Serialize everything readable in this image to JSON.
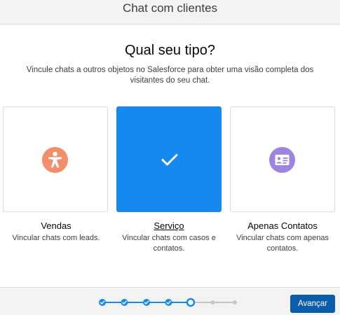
{
  "header": {
    "title": "Chat com clientes"
  },
  "main": {
    "question": "Qual seu tipo?",
    "description": "Vincule chats a outros objetos no Salesforce para obter uma visão completa dos visitantes do seu chat."
  },
  "cards": [
    {
      "title": "Vendas",
      "subtitle": "Vincular chats com leads.",
      "icon": "person-icon",
      "icon_color": "#f38d6a",
      "selected": false
    },
    {
      "title": "Serviço",
      "subtitle": "Vincular chats com casos e contatos.",
      "icon": "checkmark-icon",
      "icon_color": "#ffffff",
      "selected": true
    },
    {
      "title": "Apenas Contatos",
      "subtitle": "Vincular chats com apenas contatos.",
      "icon": "contact-card-icon",
      "icon_color": "#9c84e0",
      "selected": false
    }
  ],
  "footer": {
    "next_label": "Avançar",
    "progress": {
      "total_steps": 7,
      "current_step": 5
    }
  },
  "colors": {
    "accent": "#1589ee",
    "brand_button": "#0b5cab",
    "progress_complete": "#1589ee",
    "progress_incomplete": "#c9c7c5"
  }
}
